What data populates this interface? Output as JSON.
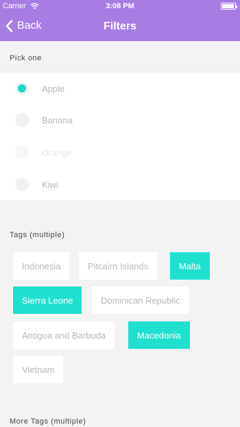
{
  "status_bar": {
    "carrier": "Carrier",
    "time": "3:08 PM",
    "battery_level": 0.95,
    "wifi_icon": "wifi-icon"
  },
  "nav": {
    "back_label": "Back",
    "title": "Filters",
    "back_icon": "chevron-left-icon"
  },
  "pick_one": {
    "label": "Pick one",
    "options": [
      {
        "label": "Apple",
        "selected": true,
        "disabled": false
      },
      {
        "label": "Banana",
        "selected": false,
        "disabled": false
      },
      {
        "label": "Orange",
        "selected": false,
        "disabled": true
      },
      {
        "label": "Kiwi",
        "selected": false,
        "disabled": false
      }
    ]
  },
  "tags": {
    "label": "Tags (multiple)",
    "items": [
      {
        "label": "Indonesia",
        "selected": false
      },
      {
        "label": "Pitcairn Islands",
        "selected": false
      },
      {
        "label": "Malta",
        "selected": true
      },
      {
        "label": "Sierra Leone",
        "selected": true
      },
      {
        "label": "Dominican Republic",
        "selected": false
      },
      {
        "label": "Antigua and Barbuda",
        "selected": false
      },
      {
        "label": "Macedonia",
        "selected": true
      },
      {
        "label": "Vietnam",
        "selected": false
      }
    ]
  },
  "more_tags": {
    "label": "More Tags (multiple)"
  },
  "colors": {
    "header": "#a77de4",
    "accent": "#1fe0cf",
    "background": "#f3f3f3"
  }
}
